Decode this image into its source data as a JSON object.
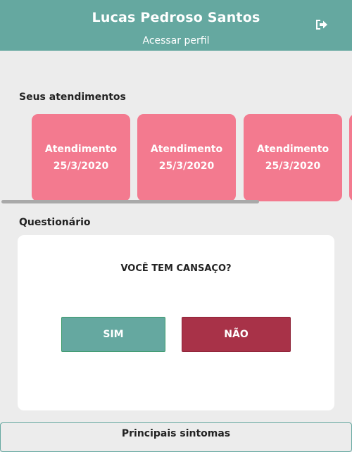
{
  "header": {
    "user_name": "Lucas Pedroso Santos",
    "profile_link": "Acessar perfil",
    "logout_icon": "sign-out-icon",
    "color": "#65a8a0"
  },
  "appointments": {
    "title": "Seus atendimentos",
    "cards": [
      {
        "label": "Atendimento",
        "date": "25/3/2020"
      },
      {
        "label": "Atendimento",
        "date": "25/3/2020"
      },
      {
        "label": "Atendimento",
        "date": "25/3/2020"
      }
    ],
    "card_color": "#f37a8f"
  },
  "questionnaire": {
    "title": "Questionário",
    "question": "VOCÊ TEM CANSAÇO?",
    "yes_label": "SIM",
    "no_label": "NÃO",
    "yes_color": "#65a8a0",
    "no_color": "#a83248"
  },
  "footer": {
    "button_label": "Principais sintomas"
  }
}
